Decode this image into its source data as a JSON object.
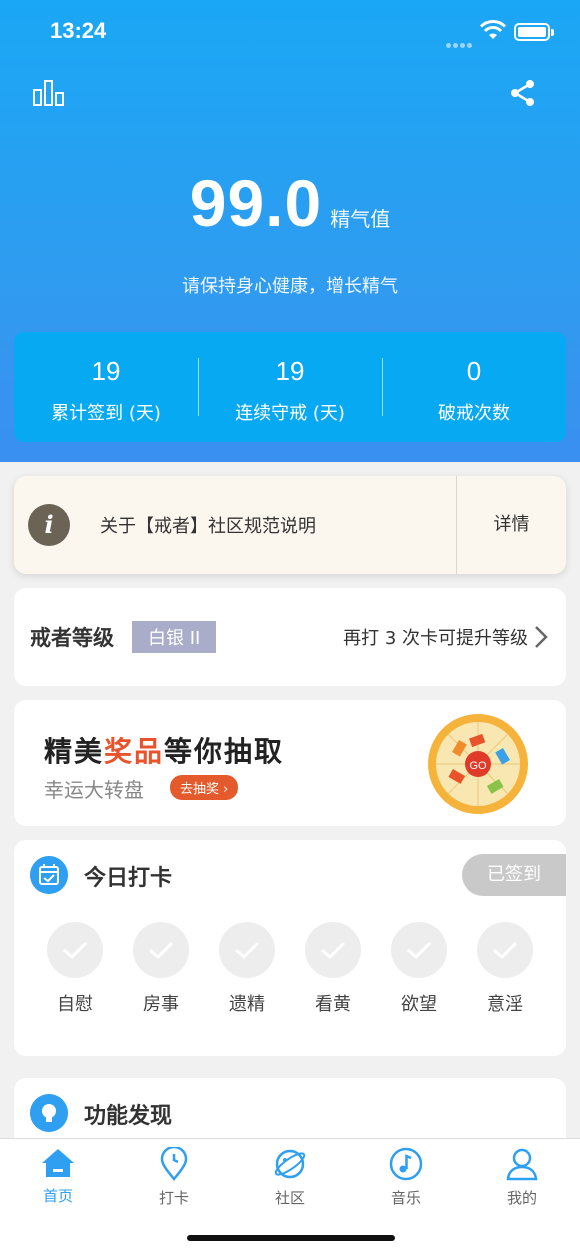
{
  "status": {
    "time": "13:24"
  },
  "hero": {
    "score": "99.0",
    "score_unit": "精气值",
    "tip": "请保持身心健康，增长精气",
    "stats": [
      {
        "value": "19",
        "label": "累计签到 (天)"
      },
      {
        "value": "19",
        "label": "连续守戒 (天)"
      },
      {
        "value": "0",
        "label": "破戒次数"
      }
    ]
  },
  "notice": {
    "text": "关于【戒者】社区规范说明",
    "detail": "详情"
  },
  "level": {
    "title": "戒者等级",
    "badge": "白银 II",
    "hint": "再打 3 次卡可提升等级"
  },
  "lottery": {
    "title_a": "精美",
    "title_hl": "奖品",
    "title_b": "等你抽取",
    "subtitle": "幸运大转盘",
    "button": "去抽奖",
    "wheel_center": "GO"
  },
  "checkin": {
    "title": "今日打卡",
    "status": "已签到",
    "items": [
      "自慰",
      "房事",
      "遗精",
      "看黄",
      "欲望",
      "意淫"
    ]
  },
  "discover": {
    "title": "功能发现"
  },
  "tabs": [
    "首页",
    "打卡",
    "社区",
    "音乐",
    "我的"
  ],
  "colors": {
    "primary": "#2f9ff2",
    "accent": "#e8532b"
  }
}
